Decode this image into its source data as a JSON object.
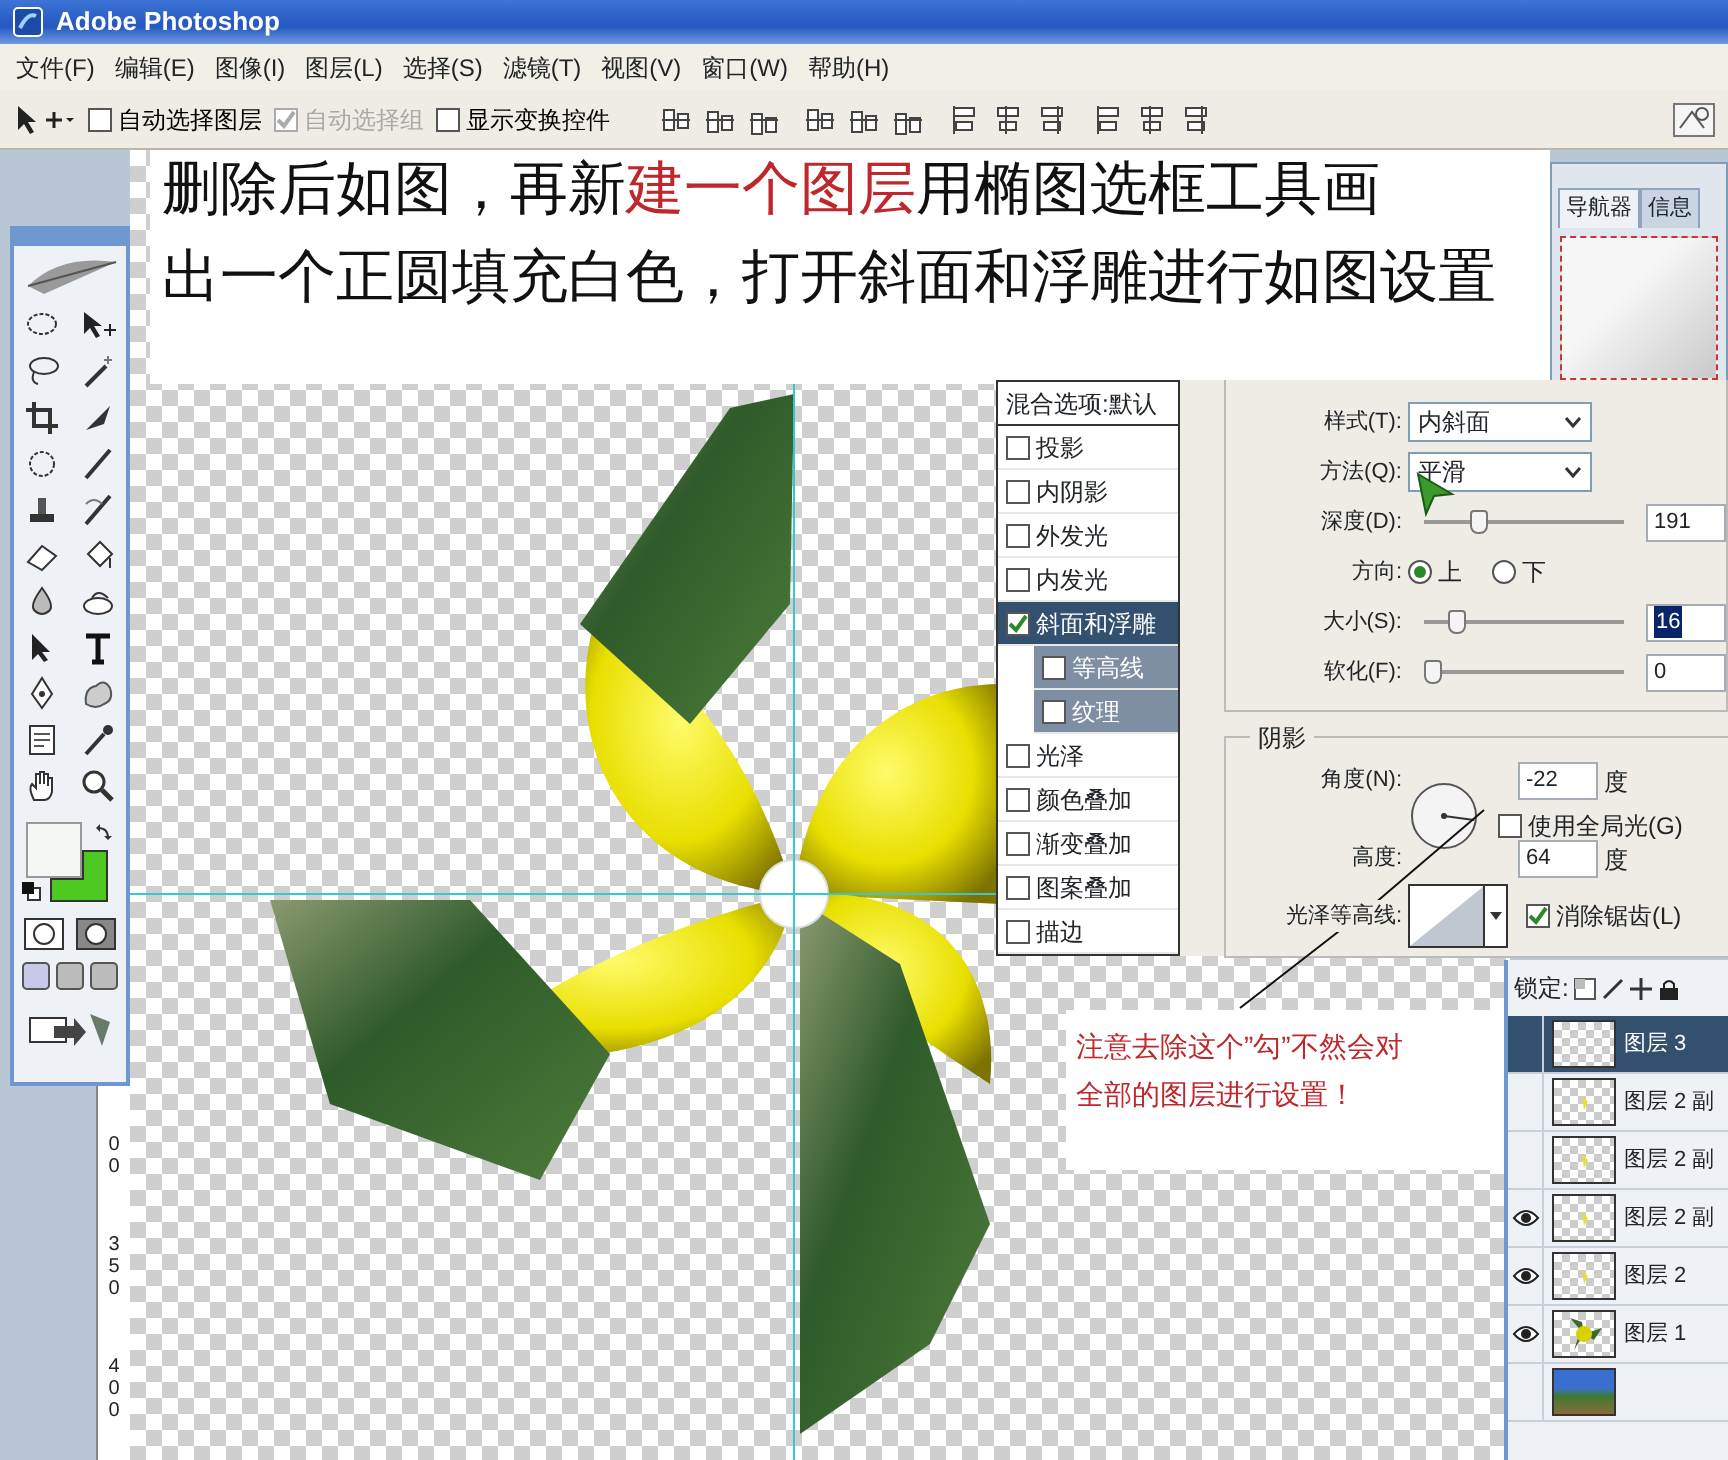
{
  "window": {
    "title": "Adobe Photoshop"
  },
  "menu": [
    {
      "label": "文件(F)"
    },
    {
      "label": "编辑(E)"
    },
    {
      "label": "图像(I)"
    },
    {
      "label": "图层(L)"
    },
    {
      "label": "选择(S)"
    },
    {
      "label": "滤镜(T)"
    },
    {
      "label": "视图(V)"
    },
    {
      "label": "窗口(W)"
    },
    {
      "label": "帮助(H)"
    }
  ],
  "options_bar": {
    "checkboxes": [
      {
        "label": "自动选择图层",
        "checked": false,
        "disabled": false
      },
      {
        "label": "自动选择组",
        "checked": true,
        "disabled": true
      },
      {
        "label": "显示变换控件",
        "checked": false,
        "disabled": false
      }
    ]
  },
  "instruction": {
    "lines": [
      [
        {
          "text": "删除后如图，再新",
          "highlight": false
        },
        {
          "text": "建一个图层",
          "highlight": true
        },
        {
          "text": "用椭图选框工具画",
          "highlight": false
        }
      ],
      [
        {
          "text": "出一个正圆填充白色，打开斜面和浮雕进行如图设置",
          "highlight": false
        }
      ]
    ]
  },
  "navigator": {
    "tabs": [
      {
        "label": "导航器",
        "selected": true
      },
      {
        "label": "信息",
        "selected": false
      }
    ]
  },
  "ruler": {
    "labels": [
      "00",
      "350",
      "400"
    ]
  },
  "layer_style": {
    "styles": [
      {
        "label": "混合选项:默认",
        "kind": "header",
        "selected": false
      },
      {
        "label": "投影",
        "kind": "effect",
        "checked": false,
        "selected": false
      },
      {
        "label": "内阴影",
        "kind": "effect",
        "checked": false,
        "selected": false
      },
      {
        "label": "外发光",
        "kind": "effect",
        "checked": false,
        "selected": false
      },
      {
        "label": "内发光",
        "kind": "effect",
        "checked": false,
        "selected": false
      },
      {
        "label": "斜面和浮雕",
        "kind": "effect",
        "checked": true,
        "selected": true
      },
      {
        "label": "等高线",
        "kind": "sub",
        "checked": false,
        "selected": false
      },
      {
        "label": "纹理",
        "kind": "sub",
        "checked": false,
        "selected": false
      },
      {
        "label": "光泽",
        "kind": "effect",
        "checked": false,
        "selected": false
      },
      {
        "label": "颜色叠加",
        "kind": "effect",
        "checked": false,
        "selected": false
      },
      {
        "label": "渐变叠加",
        "kind": "effect",
        "checked": false,
        "selected": false
      },
      {
        "label": "图案叠加",
        "kind": "effect",
        "checked": false,
        "selected": false
      },
      {
        "label": "描边",
        "kind": "effect",
        "checked": false,
        "selected": false
      }
    ],
    "structure": [
      {
        "kind": "select",
        "label": "样式(T):",
        "value": "内斜面"
      },
      {
        "kind": "select",
        "label": "方法(Q):",
        "value": "平滑"
      },
      {
        "kind": "slider",
        "label": "深度(D):",
        "level": 0.25,
        "value": "191",
        "highlight": false
      },
      {
        "kind": "radio",
        "label": "方向:",
        "options": [
          {
            "label": "上",
            "selected": true
          },
          {
            "label": "下",
            "selected": false
          }
        ]
      },
      {
        "kind": "slider",
        "label": "大小(S):",
        "level": 0.13,
        "value": "16",
        "highlight": true
      },
      {
        "kind": "slider",
        "label": "软化(F):",
        "level": 0,
        "value": "0",
        "highlight": false
      }
    ],
    "shading": {
      "title": "阴影",
      "angle": {
        "label": "角度(N):",
        "value": "-22",
        "unit": "度"
      },
      "global_light": {
        "label": "使用全局光(G)",
        "checked": false
      },
      "altitude": {
        "label": "高度:",
        "value": "64",
        "unit": "度"
      },
      "gloss_contour": {
        "label": "光泽等高线:"
      },
      "anti_aliased": {
        "label": "消除锯齿(L)",
        "checked": true
      }
    }
  },
  "note": {
    "lines": [
      "注意去除这个”勾”不然会对",
      "全部的图层进行设置！"
    ]
  },
  "layers": {
    "lock_label": "锁定:",
    "items": [
      {
        "name": "图层 3",
        "visible": false,
        "selected": true,
        "kind": "empty"
      },
      {
        "name": "图层 2 副",
        "visible": false,
        "selected": false,
        "kind": "shape"
      },
      {
        "name": "图层 2 副",
        "visible": false,
        "selected": false,
        "kind": "shape"
      },
      {
        "name": "图层 2 副",
        "visible": true,
        "selected": false,
        "kind": "shape"
      },
      {
        "name": "图层 2",
        "visible": true,
        "selected": false,
        "kind": "shape"
      },
      {
        "name": "图层 1",
        "visible": true,
        "selected": false,
        "kind": "pinwheel"
      },
      {
        "visible": false,
        "selected": false,
        "kind": "photo"
      }
    ]
  }
}
